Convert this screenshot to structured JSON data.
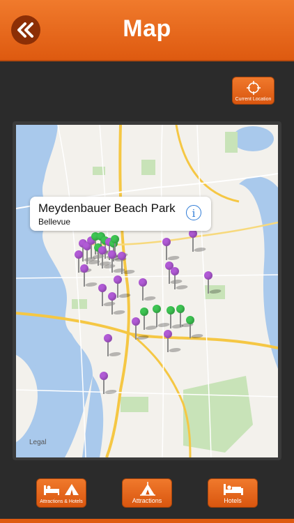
{
  "header": {
    "title": "Map",
    "back_icon": "double-chevron-left-icon"
  },
  "current_location": {
    "label": "Current Location",
    "icon": "crosshair-icon"
  },
  "map": {
    "callout": {
      "title": "Meydenbauer Beach Park",
      "subtitle": "Bellevue",
      "info_icon": "info-icon",
      "info_glyph": "i"
    },
    "legal": "Legal",
    "pin_colors": {
      "attraction": "#b15ad6",
      "hotel": "#3dc452"
    }
  },
  "bottom_bar": {
    "attractions_hotels": {
      "label": "Attractions & Hotels",
      "icon": "bed-and-tent-icon"
    },
    "attractions": {
      "label": "Attractions",
      "icon": "tent-icon"
    },
    "hotels": {
      "label": "Hotels",
      "icon": "bed-icon"
    }
  },
  "colors": {
    "accent": "#e8691e",
    "dark": "#2b2b2b"
  }
}
